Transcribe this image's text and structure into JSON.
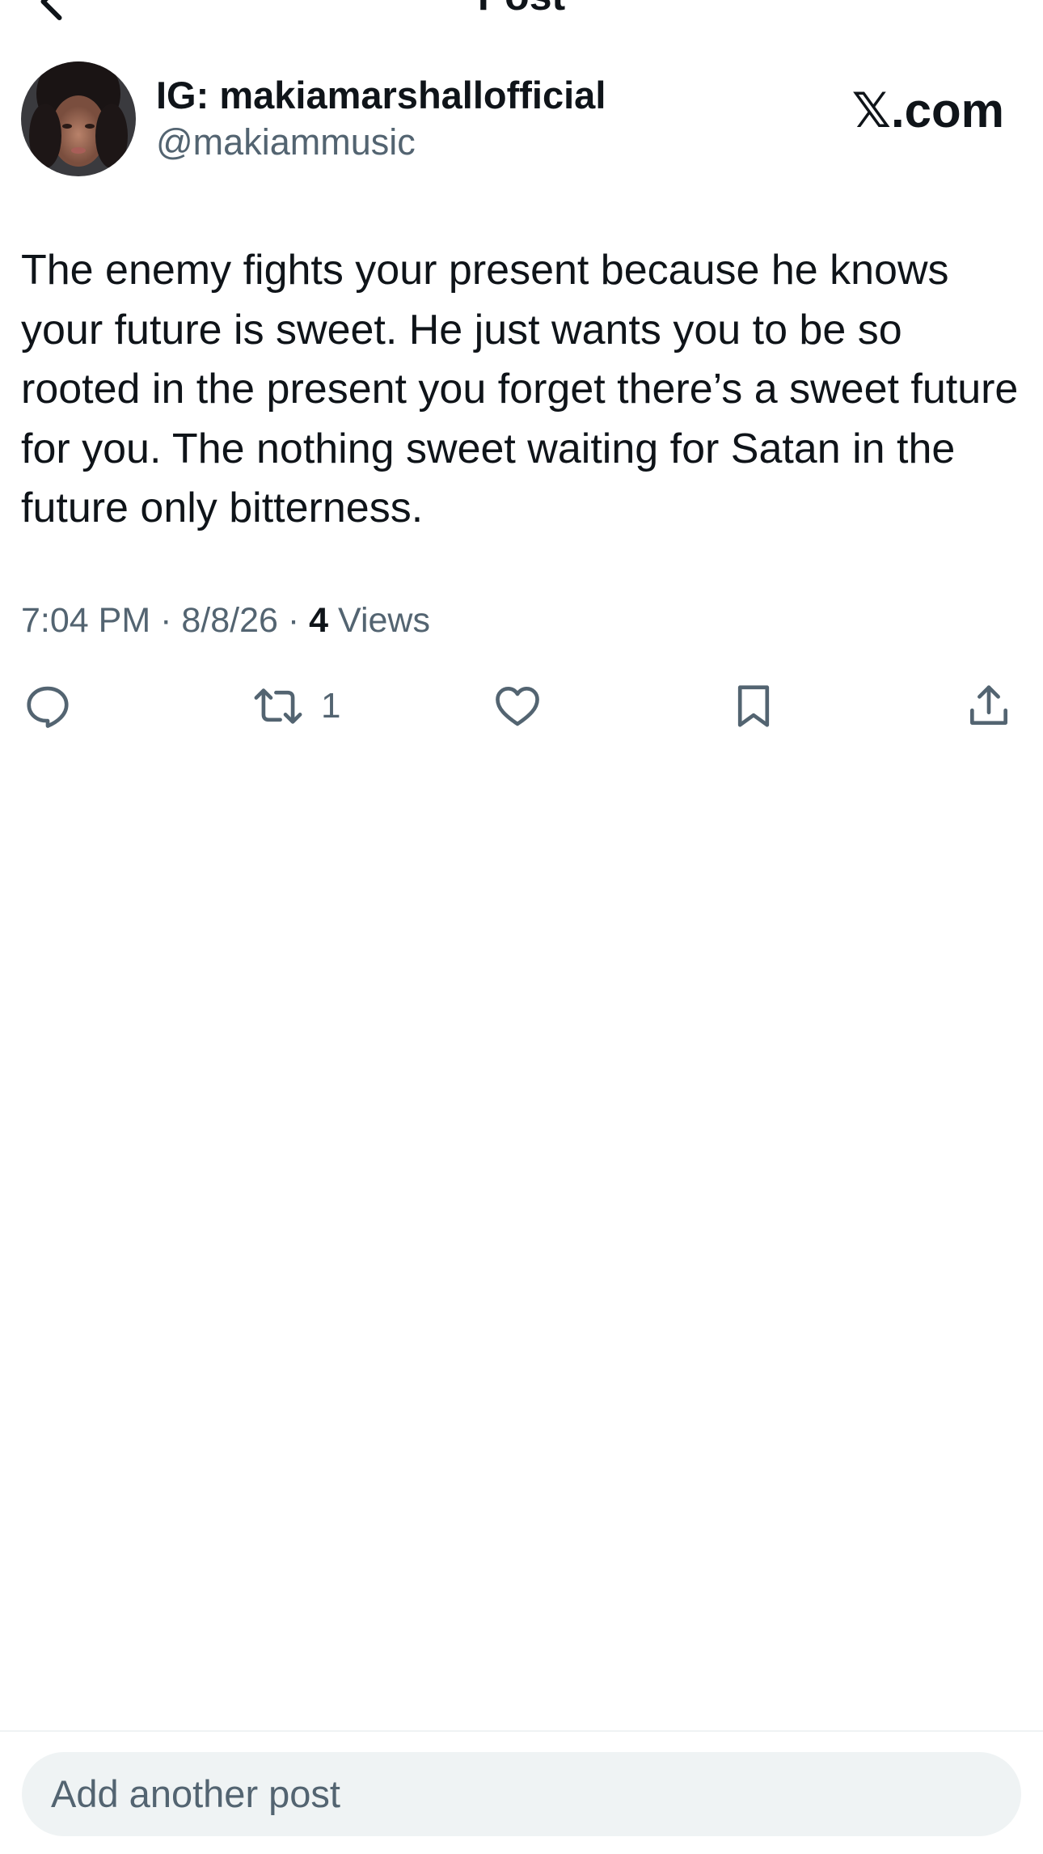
{
  "nav": {
    "title": "Post"
  },
  "author": {
    "display_name": "IG: makiamarshallofficial",
    "handle": "@makiammusic"
  },
  "brand": "𝕏.com",
  "post": {
    "text": "The enemy fights your present because he knows your future is sweet. He just wants you to be so rooted in the present you forget there’s a sweet future for you. The nothing sweet waiting for Satan in the future only bitterness.",
    "time": "7:04 PM",
    "separator": "·",
    "date": "8/8/26",
    "views_count": "4",
    "views_label": "Views"
  },
  "actions": {
    "reply_icon": "reply-icon",
    "repost_icon": "repost-icon",
    "repost_count": "1",
    "like_icon": "heart-icon",
    "bookmark_icon": "bookmark-icon",
    "share_icon": "share-icon"
  },
  "composer": {
    "placeholder": "Add another post"
  },
  "colors": {
    "text": "#0f1419",
    "secondary": "#536471",
    "composer_bg": "#eff3f4"
  }
}
